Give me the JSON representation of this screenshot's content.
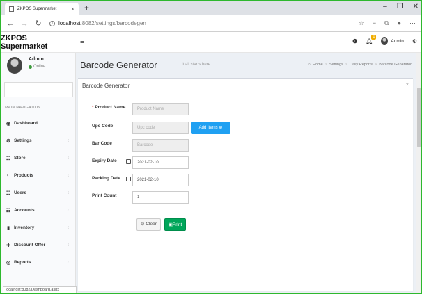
{
  "browser": {
    "tab_title": "ZKPOS Supermarket",
    "url_host": "localhost",
    "url_path": ":8082/settings/barcodegen",
    "window_controls": [
      "–",
      "❐",
      "✕"
    ],
    "status_url": "localhost:8082/Dashboard.aspx"
  },
  "app": {
    "brand": "ZKPOS Supermarket",
    "user": {
      "name": "Admin",
      "status": "Online"
    },
    "top_user": "Admin",
    "notification_count": "1"
  },
  "sidebar": {
    "header": "MAIN NAVIGATION",
    "items": [
      {
        "label": "Dashboard",
        "icon": "dashboard-icon",
        "has_children": false
      },
      {
        "label": "Settings",
        "icon": "gear-icon",
        "has_children": true
      },
      {
        "label": "Store",
        "icon": "users-icon",
        "has_children": true
      },
      {
        "label": "Products",
        "icon": "products-icon",
        "has_children": true
      },
      {
        "label": "Users",
        "icon": "users-icon",
        "has_children": true
      },
      {
        "label": "Accounts",
        "icon": "users-icon",
        "has_children": true
      },
      {
        "label": "Inventory",
        "icon": "chart-icon",
        "has_children": true
      },
      {
        "label": "Discount Offer",
        "icon": "plus-icon",
        "has_children": true
      },
      {
        "label": "Reports",
        "icon": "eye-icon",
        "has_children": true
      }
    ]
  },
  "page": {
    "title": "Barcode Generator",
    "subtitle": "It all starts here",
    "breadcrumb": [
      "Home",
      "Settings",
      "Daily Reports",
      "Barcode Generator"
    ]
  },
  "form": {
    "box_title": "Barcode Generator",
    "product_name": {
      "label": "Product Name",
      "required_mark": "*",
      "placeholder": "Product Name"
    },
    "upc_code": {
      "label": "Upc Code",
      "placeholder": "Upc code"
    },
    "add_items_label": "Add Items",
    "bar_code": {
      "label": "Bar Code",
      "placeholder": "Barcode"
    },
    "expiry_date": {
      "label": "Expiry Date",
      "value": "2021-02-10"
    },
    "packing_date": {
      "label": "Packing Date",
      "value": "2021-02-10"
    },
    "print_count": {
      "label": "Print Count",
      "value": "1"
    },
    "clear_label": "Clear",
    "print_label": "Print"
  },
  "colors": {
    "add_button": "#1fa0f2",
    "print_button": "#00a65a",
    "online_dot": "#3c9a3c",
    "frame_border": "#2eb82e"
  }
}
